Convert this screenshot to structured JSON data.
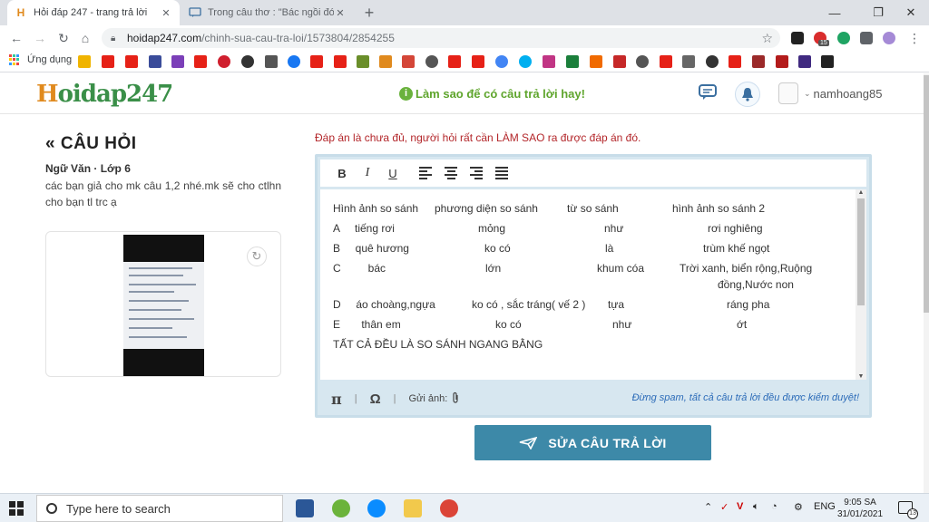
{
  "browser": {
    "tabs": [
      {
        "title": "Hỏi đáp 247 - trang trả lời",
        "active": true,
        "favicon": "H"
      },
      {
        "title": "Trong câu thơ : \"Bác ngồi đó lớn",
        "active": false
      }
    ],
    "url_host": "hoidap247.com",
    "url_path": "/chinh-sua-cau-tra-loi/1573804/2854255",
    "bookmarks_label": "Ứng dụng",
    "extension_badge": "15"
  },
  "site": {
    "logo_h": "H",
    "logo_rest": "oidap247",
    "tip": "Làm sao để có câu trả lời hay!",
    "username": "namhoang85"
  },
  "question": {
    "title": "« CÂU HỎI",
    "meta": "Ngữ Văn · Lớp 6",
    "body": "các bạn giả cho mk câu 1,2  nhé.mk sẽ cho ctlhn cho bạn tl trc ạ"
  },
  "editor": {
    "warning": "Đáp án là chưa đủ, người hỏi rất cần LÀM SAO ra được đáp án đó.",
    "rows": [
      [
        "Hình ảnh so sánh",
        "phương diện so sánh",
        "từ so sánh",
        "hình ảnh so sánh 2"
      ],
      [
        "A     tiếng rơi",
        "mỏng",
        "như",
        "rơi nghiêng"
      ],
      [
        "B     quê hương",
        "ko có",
        "là",
        "trùm khế ngọt"
      ],
      [
        "C         bác",
        "lớn",
        "khum cóa",
        "Trời xanh, biển rộng,Ruộng"
      ],
      [
        "",
        "",
        "",
        "đồng,Nước non"
      ],
      [
        "D     áo choàng,ngựa",
        "ko có , sắc tráng( vế 2 )",
        "tựa",
        "ráng pha"
      ],
      [
        "E       thân em",
        "ko có",
        "như",
        "ớt"
      ],
      [
        "TẤT CẢ ĐỀU LÀ SO SÁNH NGANG BẰNG",
        "",
        "",
        ""
      ]
    ],
    "toolbar": {
      "bold": "B",
      "italic": "I",
      "underline": "U"
    },
    "attach_label": "Gửi ảnh:",
    "spam_note": "Đừng spam, tất cả câu trả lời đều được kiểm duyệt!",
    "submit_label": "SỬA CÂU TRẢ LỜI"
  },
  "taskbar": {
    "search_placeholder": "Type here to search",
    "lang": "ENG",
    "time": "9:05 SA",
    "date": "31/01/2021",
    "notif_count": "13"
  }
}
